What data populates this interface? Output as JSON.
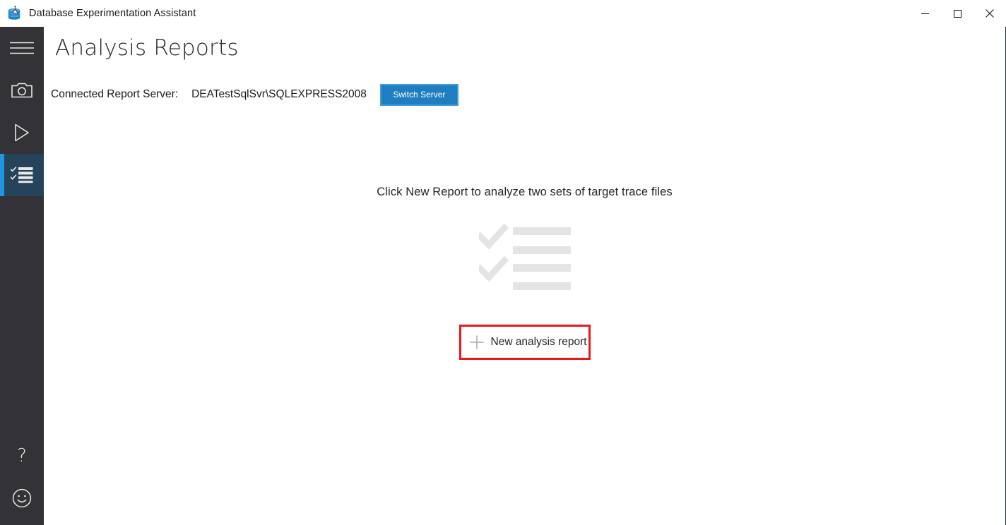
{
  "window": {
    "title": "Database Experimentation Assistant",
    "app_icon": "database-flask-icon",
    "controls": [
      {
        "name": "minimize-button",
        "icon": "minimize-icon",
        "label": "Minimize"
      },
      {
        "name": "maximize-button",
        "icon": "maximize-icon",
        "label": "Maximize"
      },
      {
        "name": "close-button",
        "icon": "close-icon",
        "label": "Close"
      }
    ]
  },
  "sidebar": {
    "background": "#333337",
    "selected_background": "#25435a",
    "accent": "#1f97e0",
    "top_items": [
      {
        "name": "menu-toggle",
        "icon": "hamburger-menu-icon",
        "label": "Menu",
        "selected": false
      },
      {
        "name": "sidebar-item-capture",
        "icon": "camera-icon",
        "label": "Capture",
        "selected": false
      },
      {
        "name": "sidebar-item-replay",
        "icon": "play-icon",
        "label": "Replay",
        "selected": false
      },
      {
        "name": "sidebar-item-analysis-reports",
        "icon": "checklist-icon",
        "label": "Analysis Reports",
        "selected": true
      }
    ],
    "bottom_items": [
      {
        "name": "sidebar-item-help",
        "icon": "question-mark-icon",
        "label": "Help",
        "selected": false
      },
      {
        "name": "sidebar-item-feedback",
        "icon": "smiley-face-icon",
        "label": "Feedback",
        "selected": false
      }
    ]
  },
  "main": {
    "page_title": "Analysis Reports",
    "server": {
      "label": "Connected Report Server:",
      "value": "DEATestSqlSvr\\SQLEXPRESS2008",
      "switch_button_label": "Switch Server",
      "switch_button_color": "#1f7ec0",
      "switch_button_border": "#3d9be3"
    },
    "empty_state": {
      "hint": "Click New Report to analyze two sets of target trace files",
      "graphic_icon": "checklist-placeholder-graphic",
      "graphic_color": "#e4e4e4",
      "new_report_label": "New analysis report",
      "new_report_icon": "plus-icon"
    },
    "annotation": {
      "name": "red-highlight-box",
      "color": "#e8191b"
    }
  }
}
